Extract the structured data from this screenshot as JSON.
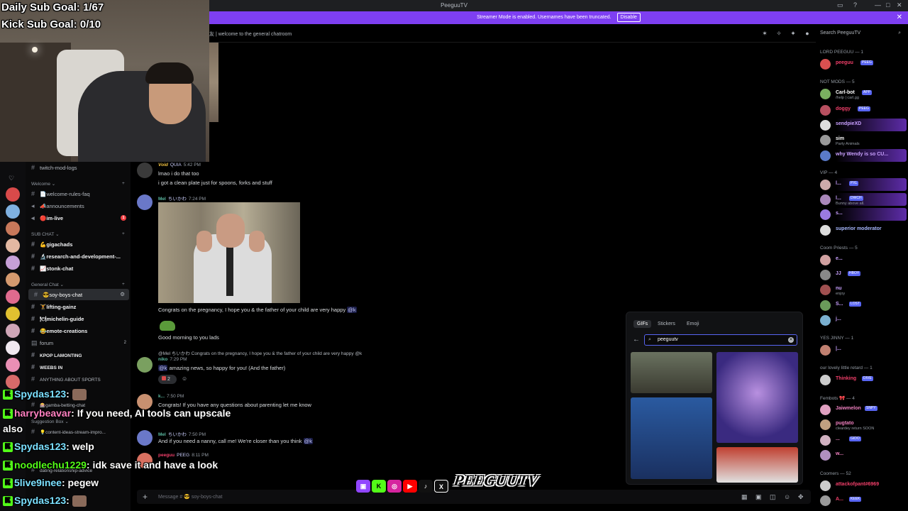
{
  "app": {
    "title": "PeeguuTV",
    "window_controls": [
      "—",
      "□",
      "✕"
    ]
  },
  "banner": {
    "text": "Streamer Mode is enabled. Usernames have been truncated.",
    "disable_label": "Disable",
    "close_label": "✕"
  },
  "header": {
    "topic": "友 | welcome to the general chatroom",
    "search_placeholder": "Search PeeguuTV"
  },
  "overlay_goals": {
    "daily": "Daily Sub Goal: 1/67",
    "kick": "Kick Sub Goal: 0/10"
  },
  "sidebar": {
    "items": [
      {
        "label": "twitch-mod-logs"
      },
      {
        "label": "Welcome ⌄"
      },
      {
        "label": "📄welcome-rules-faq"
      },
      {
        "label": "📣announcements"
      },
      {
        "label": "🔴im-live",
        "badge": "1"
      },
      {
        "label": "SUB CHAT ⌄"
      },
      {
        "label": "💪gigachads"
      },
      {
        "label": "🔬research-and-development-..."
      },
      {
        "label": "📈stonk-chat"
      },
      {
        "label": "General Chat ⌄"
      },
      {
        "label": "😎soy-boys-chat"
      },
      {
        "label": "🏋lifting-gainz"
      },
      {
        "label": "🍽michelin-guide"
      },
      {
        "label": "😂emote-creations"
      },
      {
        "label": "forum",
        "count": "2"
      },
      {
        "label": "KPOP LAMONTING"
      },
      {
        "label": "WEEBS IN"
      },
      {
        "label": "ANYTHING ABOUT SPORTS"
      },
      {
        "label": "🎰gamba-betting-chat"
      },
      {
        "label": "Suggestion Box ⌄"
      },
      {
        "label": "💡content-ideas-stream-impro..."
      },
      {
        "label": "dating-relationship-advice"
      }
    ]
  },
  "stream_chat": [
    {
      "user": "Spydas123",
      "text": ":"
    },
    {
      "user": "harrybeavar",
      "text": ": If you need, AI tools can upscale"
    },
    {
      "user": "",
      "text": "also"
    },
    {
      "user": "Spydas123",
      "text": ": welp"
    },
    {
      "user": "noodlechu1229",
      "text": ": idk save it and have a look"
    },
    {
      "user": "5live9inee",
      "text": ": pegew"
    },
    {
      "user": "Spydas123",
      "text": ":"
    }
  ],
  "messages": [
    {
      "name": "Void",
      "role": "QUIA",
      "time": "5:42 PM",
      "lines": [
        "lmao i do that too",
        "i got a clean plate just for spoons, forks and stuff"
      ]
    },
    {
      "name": "Mel",
      "role": "ちいかわ",
      "time": "7:24 PM",
      "caption": "Congrats on the pregnancy, I hope you & the father of your child are very happy",
      "mention": "@k",
      "after": "Good morning to you lads"
    },
    {
      "name": "niko",
      "time": "7:29 PM",
      "reply": "@Mel ちいかわ Congrats on the pregnancy, I hope you & the father of your child are very happy @k",
      "text": "amazing news, so happy for you! (And the father)",
      "mention": "@k",
      "reaction_count": "2"
    },
    {
      "name": "k...",
      "time": "7:50 PM",
      "text": "Congrats! If you have any questions about parenting let me know"
    },
    {
      "name": "Mel",
      "role": "ちいかわ",
      "time": "7:50 PM",
      "text": "And if you need a nanny, call me! We're closer than you think",
      "mention": "@k"
    },
    {
      "name": "peeguu",
      "role": "PEEG",
      "time": "8:11 PM"
    }
  ],
  "input": {
    "placeholder": "Message # 😎 soy-boys-chat"
  },
  "brand": "PEEGUUTV",
  "picker": {
    "tabs": [
      "GIFs",
      "Stickers",
      "Emoji"
    ],
    "search_value": "peeguutv"
  },
  "members": {
    "groups": [
      {
        "label": "LORD PEEGUU — 1"
      },
      {
        "label": "NOT MODS — 5"
      },
      {
        "label": "VIP — 4"
      },
      {
        "label": "Coom Priests — 5"
      },
      {
        "label": "YES JINNY — 1"
      },
      {
        "label": "our lovely little retard — 1"
      },
      {
        "label": "Fembots 🎀 — 4"
      },
      {
        "label": "Coomers — 52"
      }
    ],
    "list": [
      {
        "name": "peeguu",
        "tag": "PEEG"
      },
      {
        "name": "Carl-bot",
        "tag": "APP",
        "sub": "/help | carl.gg"
      },
      {
        "name": "doggy",
        "tag": "PEEG"
      },
      {
        "name": "sendpieXD"
      },
      {
        "name": "sim",
        "sub": "Party Animals"
      },
      {
        "name": "why Wendy is so CU..."
      },
      {
        "name": "l...",
        "tag": "PXL"
      },
      {
        "name": "l...",
        "tag": "DWCH",
        "sub": "Bunny above all."
      },
      {
        "name": "s..."
      },
      {
        "name": "superior moderator"
      },
      {
        "name": "e..."
      },
      {
        "name": "JJ",
        "tag": "HBOY"
      },
      {
        "name": "nu",
        "sub": "enjoy"
      },
      {
        "name": "S...",
        "tag": "LOST"
      },
      {
        "name": "j..."
      },
      {
        "name": "Thinking",
        "tag": "DIVE"
      },
      {
        "name": "Jaiwmelon",
        "tag": "SNPY"
      },
      {
        "name": "pugtato",
        "sub": "cleardey return SOON"
      },
      {
        "name": "...",
        "tag": "GIDO"
      },
      {
        "name": "w..."
      },
      {
        "name": "attackofpant#6969"
      },
      {
        "name": "A...",
        "tag": "KEEK"
      }
    ]
  },
  "colors": {
    "accent": "#7e3ff2",
    "blurple": "#5865f2",
    "kick_green": "#53fc18"
  }
}
